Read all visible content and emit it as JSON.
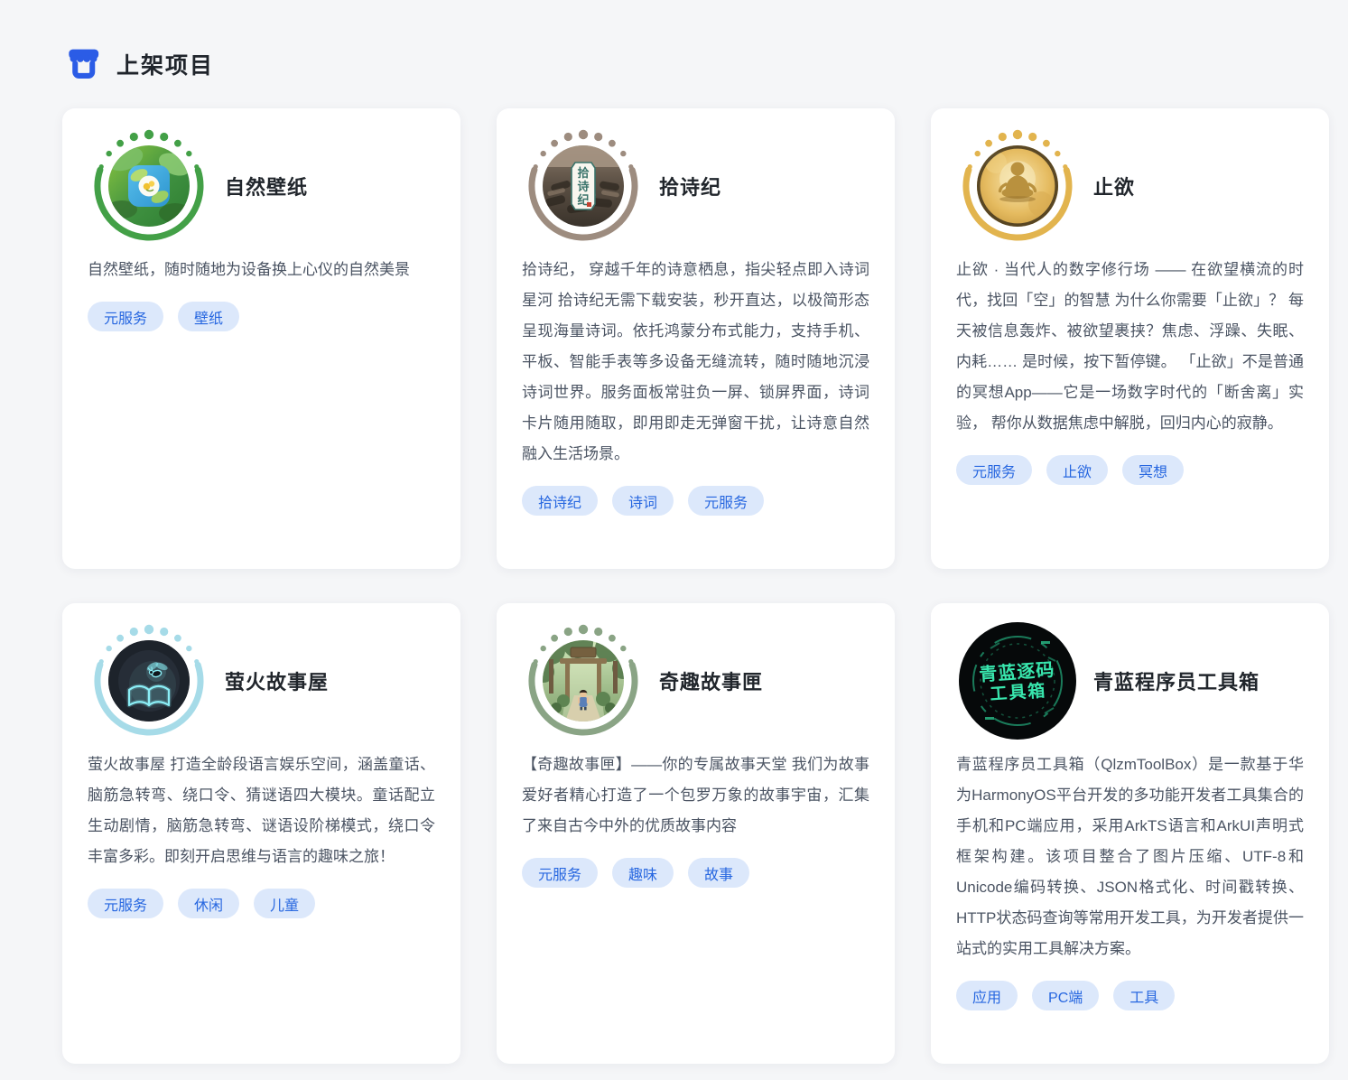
{
  "header": {
    "title": "上架项目",
    "icon": "storefront-icon"
  },
  "colors": {
    "page_bg": "#f5f6f8",
    "card_bg": "#ffffff",
    "header_icon_blue": "#2b5ce6",
    "tag_bg": "#dce8fb",
    "tag_text": "#2767e0",
    "title_text": "#21262c",
    "description_text": "#4b5463"
  },
  "cards": [
    {
      "title": "自然壁纸",
      "description": "自然壁纸，随时随地为设备换上心仪的自然美景",
      "tags": [
        "元服务",
        "壁纸"
      ],
      "ring_color": "#43a047"
    },
    {
      "title": "拾诗纪",
      "description": "拾诗纪， 穿越千年的诗意栖息，指尖轻点即入诗词星河 拾诗纪无需下载安装，秒开直达，以极简形态呈现海量诗词。依托鸿蒙分布式能力，支持手机、平板、智能手表等多设备无缝流转，随时随地沉浸诗词世界。服务面板常驻负一屏、锁屏界面，诗词卡片随用随取，即用即走无弹窗干扰，让诗意自然融入生活场景。",
      "tags": [
        "拾诗纪",
        "诗词",
        "元服务"
      ],
      "ring_color": "#9d8c7f",
      "avatar_chars": [
        "拾",
        "诗",
        "纪"
      ]
    },
    {
      "title": "止欲",
      "description": "止欲 · 当代人的数字修行场 —— 在欲望横流的时代，找回「空」的智慧 为什么你需要「止欲」？ 每天被信息轰炸、被欲望裹挟？焦虑、浮躁、失眠、内耗…… 是时候，按下暂停键。 「止欲」不是普通的冥想App——它是一场数字时代的「断舍离」实验， 帮你从数据焦虑中解脱，回归内心的寂静。",
      "tags": [
        "元服务",
        "止欲",
        "冥想"
      ],
      "ring_color": "#e2b44e"
    },
    {
      "title": "萤火故事屋",
      "description": "萤火故事屋 打造全龄段语言娱乐空间，涵盖童话、脑筋急转弯、绕口令、猜谜语四大模块。童话配立生动剧情，脑筋急转弯、谜语设阶梯模式，绕口令丰富多彩。即刻开启思维与语言的趣味之旅！",
      "tags": [
        "元服务",
        "休闲",
        "儿童"
      ],
      "ring_color": "#a6dbe8"
    },
    {
      "title": "奇趣故事匣",
      "description": "【奇趣故事匣】——你的专属故事天堂 我们为故事爱好者精心打造了一个包罗万象的故事宇宙，汇集了来自古今中外的优质故事内容",
      "tags": [
        "元服务",
        "趣味",
        "故事"
      ],
      "ring_color": "#8aa485"
    },
    {
      "title": "青蓝程序员工具箱",
      "description": "青蓝程序员工具箱（QlzmToolBox）是一款基于华为HarmonyOS平台开发的多功能开发者工具集合的手机和PC端应用，采用ArkTS语言和ArkUI声明式框架构建。该项目整合了图片压缩、UTF-8和Unicode编码转换、JSON格式化、时间戳转换、HTTP状态码查询等常用开发工具，为开发者提供一站式的实用工具解决方案。",
      "tags": [
        "应用",
        "PC端",
        "工具"
      ],
      "avatar_lines": [
        "青蓝逐码",
        "工具箱"
      ]
    }
  ]
}
